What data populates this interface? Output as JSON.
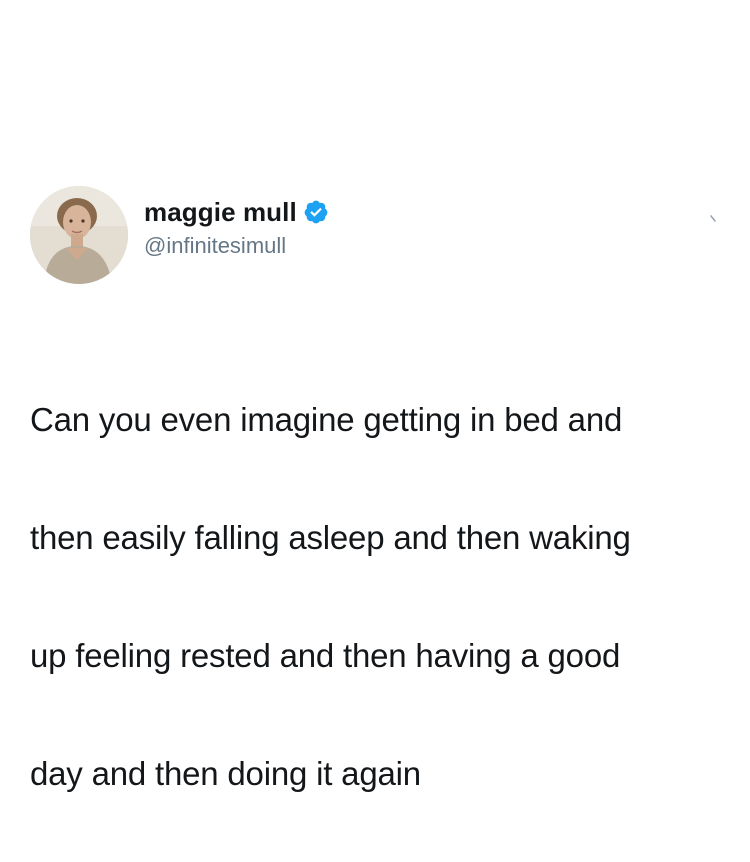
{
  "tweet": {
    "author": {
      "display_name": "maggie mull",
      "handle": "@infinitesimull",
      "verified": true,
      "avatar_icon": "profile-photo"
    },
    "text_lines": [
      "Can you even imagine getting in bed and",
      "then easily falling asleep and then waking",
      "up feeling rested and then having a good",
      "day and then doing it again"
    ],
    "menu_icon": "chevron-down-icon"
  },
  "colors": {
    "background": "#ffffff",
    "name": "#14171a",
    "handle": "#657786",
    "verified_badge": "#1da1f2",
    "text": "#14171a"
  }
}
